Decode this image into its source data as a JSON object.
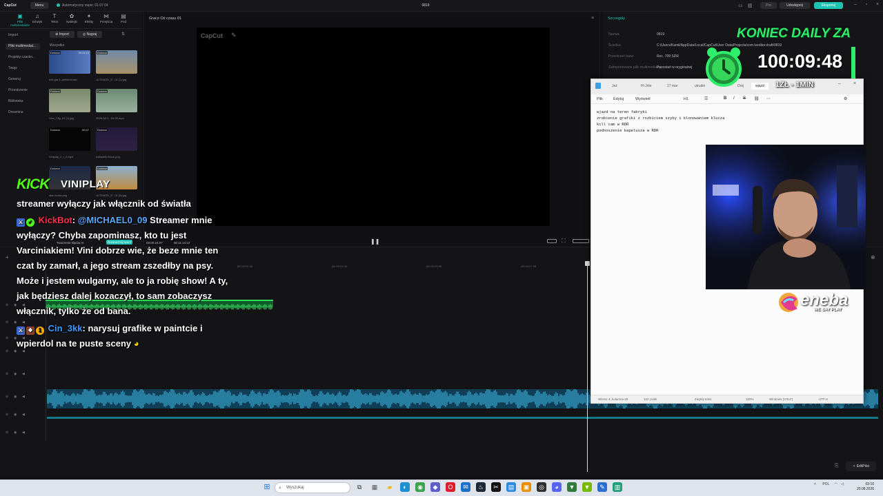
{
  "topbar": {
    "logo": "CapCut",
    "menu": "Menu",
    "autosave": "Automatyczny zapis: 01:07:04",
    "project": "0819",
    "pro": "Pro",
    "share": "Udostępnij",
    "export": "Eksportuj"
  },
  "media_tabs": [
    {
      "icon": "▣",
      "label": "Pliki multimedialne"
    },
    {
      "icon": "♫",
      "label": "Dźwięk"
    },
    {
      "icon": "T",
      "label": "Tekst"
    },
    {
      "icon": "✿",
      "label": "Naklejki"
    },
    {
      "icon": "✦",
      "label": "Efekty"
    },
    {
      "icon": "⋈",
      "label": "Przejścia"
    },
    {
      "icon": "▤",
      "label": "Pod"
    }
  ],
  "media_sidebar": [
    "Import",
    "Pliki multimedial...",
    "Projekty czasko...",
    "Twoje",
    "Generuj",
    "Przestrzenie",
    "Biblioteka",
    "Dreamina"
  ],
  "media_toolbar": {
    "import": "Import",
    "filter": "Nagraj",
    "all": "Wszystko"
  },
  "media_items": [
    {
      "tag": "Dodano",
      "dur": "00:11:12",
      "caption": "kob gta 5_ambient.wav"
    },
    {
      "tag": "Dodano",
      "dur": "",
      "caption": "ULTIMATE_E...01 (1).jpg"
    },
    {
      "tag": "Dodano",
      "dur": "",
      "caption": "Vice_City_03 (1).jpg"
    },
    {
      "tag": "Dodano",
      "dur": "",
      "caption": "2026-08-1...34-25.mp4"
    },
    {
      "tag": "Dodano",
      "dur": "00:47",
      "caption": "Viniplay_2_r_2.mp4"
    },
    {
      "tag": "Dodano",
      "dur": "",
      "caption": "wskaźnik focus.png"
    },
    {
      "tag": "Dodano",
      "dur": "",
      "caption": "stan konta.png"
    },
    {
      "tag": "Dodano",
      "dur": "",
      "caption": "ULTIMATE_E...01 (5).jpg"
    }
  ],
  "preview": {
    "title": "Gracz-Oś czasu 01",
    "watermark": "CapCut"
  },
  "details": {
    "title": "Szczegóły",
    "rows": [
      {
        "k": "Nazwa:",
        "v": "0819"
      },
      {
        "k": "Ścieżka:",
        "v": "C:/Users/Kamil/AppData/Local/CapCut/User Data/Projects/com.lveditor.draft/0819"
      },
      {
        "k": "Przestrzeń barw:",
        "v": "Rec. 709 SDR"
      },
      {
        "k": "Zaimportowane pliki multimedialne:",
        "v": "Pozostań w oryginalnej"
      }
    ]
  },
  "timeline": {
    "ruler": [
      "|00:00:01:36",
      "|00:00:03:36",
      "|00:00:05:36",
      "|00:00:07:36"
    ],
    "clip_labels": [
      "Tworzenie klipów AI",
      "Rozpocznij tworz",
      "00:00:24:07",
      "00:11:14:12"
    ]
  },
  "notepad": {
    "tabs": [
      "Jeż",
      "Hi Jóte",
      "17 mar",
      "utrudni",
      "Droj",
      "wjazd"
    ],
    "menu": [
      "Plik",
      "Edytuj",
      "Wyświetl"
    ],
    "heading": "H1",
    "text": "wjazd na teren fabryki\nzrobienie grafiki z rozbiciem szyby i klonowaniem klucza\nkill cam w RDR\npodnoszenie kapelusza w RDR",
    "status": [
      "Wiersz 4, kolumna 28",
      "122 znaki",
      "Zwykły tekst",
      "100%",
      "Windows (CRLF)",
      "UTF-8"
    ]
  },
  "overlay": {
    "timer_title": "KONIEC DAILY ZA",
    "timer_value": "100:09:48",
    "timer_sub": "1ZŁ - 1MIN",
    "kick_logo": "KICK",
    "streamer": "VINIPLAY",
    "sponsor": "eneba",
    "sponsor_sub": "WE SAY PLAY"
  },
  "chat": {
    "line0": "streamer wyłączy jak włącznik od światła",
    "msg1_user": "KickBot",
    "msg1_mention": "@MICHAEL0_09",
    "msg1_text": " Streamer mnie wyłączy? Chyba zapominasz, kto tu jest Varciniakiem! Vini dobrze wie, że beze mnie ten czat by zamarł, a jego stream zszedłby na psy. Może i jestem wulgarny, ale to ja robię show! A ty, jak będziesz dalej kozaczył, to sam zobaczysz włącznik, tylko że od bana.",
    "msg2_user": "Cin_3kk",
    "msg2_text": " narysuj grafike w paintcie i wpierdol na te puste sceny"
  },
  "taskbar": {
    "search": "Wyszukaj",
    "lang": "POL",
    "time": "03:10",
    "date": "20.08.2026"
  },
  "editpilot": "EditPilot",
  "colors": {
    "accent": "#1fc3b4",
    "kick_green": "#53fc18",
    "timer_green": "#2fef6a"
  }
}
